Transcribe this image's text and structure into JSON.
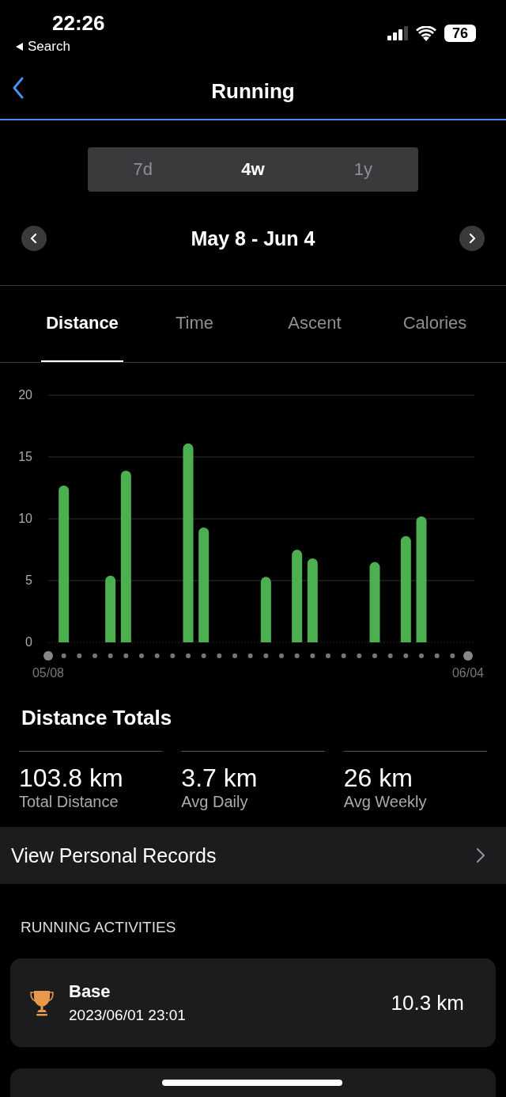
{
  "status_bar": {
    "time": "22:26",
    "back_label": "Search",
    "battery": "76"
  },
  "nav": {
    "title": "Running"
  },
  "periods": [
    {
      "label": "7d",
      "selected": false
    },
    {
      "label": "4w",
      "selected": true
    },
    {
      "label": "1y",
      "selected": false
    }
  ],
  "date_range": "May 8 - Jun 4",
  "metric_tabs": [
    {
      "label": "Distance",
      "selected": true
    },
    {
      "label": "Time",
      "selected": false
    },
    {
      "label": "Ascent",
      "selected": false
    },
    {
      "label": "Calories",
      "selected": false
    }
  ],
  "chart_data": {
    "type": "bar",
    "categories": [
      "05/08",
      null,
      null,
      null,
      null,
      null,
      null,
      null,
      null,
      null,
      null,
      null,
      null,
      null,
      null,
      null,
      null,
      null,
      null,
      null,
      null,
      null,
      null,
      null,
      null,
      null,
      null,
      "06/04"
    ],
    "series": [
      {
        "color": "#4caf50",
        "values": [
          0,
          12.7,
          0,
          0,
          5.4,
          13.9,
          0,
          0,
          0,
          16.1,
          9.3,
          0,
          0,
          0,
          5.3,
          0,
          7.5,
          6.8,
          0,
          0,
          0,
          6.5,
          0,
          8.6,
          10.2,
          0,
          0,
          0
        ]
      }
    ],
    "ylim": [
      0,
      20
    ],
    "yticks": [
      0,
      5,
      10,
      15,
      20
    ],
    "grid": true
  },
  "totals": {
    "title": "Distance Totals",
    "stats": [
      {
        "value": "103.8 km",
        "label": "Total Distance"
      },
      {
        "value": "3.7 km",
        "label": "Avg Daily"
      },
      {
        "value": "26 km",
        "label": "Avg Weekly"
      }
    ]
  },
  "records_link": "View Personal Records",
  "activities": {
    "header": "RUNNING ACTIVITIES",
    "items": [
      {
        "name": "Base",
        "date": "2023/06/01 23:01",
        "distance": "10.3 km"
      }
    ]
  }
}
